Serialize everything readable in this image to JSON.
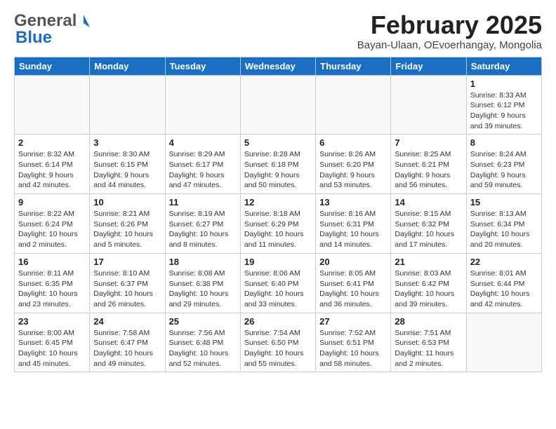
{
  "logo": {
    "general": "General",
    "blue": "Blue"
  },
  "title": "February 2025",
  "location": "Bayan-Ulaan, OEvoerhangay, Mongolia",
  "days_of_week": [
    "Sunday",
    "Monday",
    "Tuesday",
    "Wednesday",
    "Thursday",
    "Friday",
    "Saturday"
  ],
  "weeks": [
    [
      {
        "day": "",
        "info": ""
      },
      {
        "day": "",
        "info": ""
      },
      {
        "day": "",
        "info": ""
      },
      {
        "day": "",
        "info": ""
      },
      {
        "day": "",
        "info": ""
      },
      {
        "day": "",
        "info": ""
      },
      {
        "day": "1",
        "info": "Sunrise: 8:33 AM\nSunset: 6:12 PM\nDaylight: 9 hours and 39 minutes."
      }
    ],
    [
      {
        "day": "2",
        "info": "Sunrise: 8:32 AM\nSunset: 6:14 PM\nDaylight: 9 hours and 42 minutes."
      },
      {
        "day": "3",
        "info": "Sunrise: 8:30 AM\nSunset: 6:15 PM\nDaylight: 9 hours and 44 minutes."
      },
      {
        "day": "4",
        "info": "Sunrise: 8:29 AM\nSunset: 6:17 PM\nDaylight: 9 hours and 47 minutes."
      },
      {
        "day": "5",
        "info": "Sunrise: 8:28 AM\nSunset: 6:18 PM\nDaylight: 9 hours and 50 minutes."
      },
      {
        "day": "6",
        "info": "Sunrise: 8:26 AM\nSunset: 6:20 PM\nDaylight: 9 hours and 53 minutes."
      },
      {
        "day": "7",
        "info": "Sunrise: 8:25 AM\nSunset: 6:21 PM\nDaylight: 9 hours and 56 minutes."
      },
      {
        "day": "8",
        "info": "Sunrise: 8:24 AM\nSunset: 6:23 PM\nDaylight: 9 hours and 59 minutes."
      }
    ],
    [
      {
        "day": "9",
        "info": "Sunrise: 8:22 AM\nSunset: 6:24 PM\nDaylight: 10 hours and 2 minutes."
      },
      {
        "day": "10",
        "info": "Sunrise: 8:21 AM\nSunset: 6:26 PM\nDaylight: 10 hours and 5 minutes."
      },
      {
        "day": "11",
        "info": "Sunrise: 8:19 AM\nSunset: 6:27 PM\nDaylight: 10 hours and 8 minutes."
      },
      {
        "day": "12",
        "info": "Sunrise: 8:18 AM\nSunset: 6:29 PM\nDaylight: 10 hours and 11 minutes."
      },
      {
        "day": "13",
        "info": "Sunrise: 8:16 AM\nSunset: 6:31 PM\nDaylight: 10 hours and 14 minutes."
      },
      {
        "day": "14",
        "info": "Sunrise: 8:15 AM\nSunset: 6:32 PM\nDaylight: 10 hours and 17 minutes."
      },
      {
        "day": "15",
        "info": "Sunrise: 8:13 AM\nSunset: 6:34 PM\nDaylight: 10 hours and 20 minutes."
      }
    ],
    [
      {
        "day": "16",
        "info": "Sunrise: 8:11 AM\nSunset: 6:35 PM\nDaylight: 10 hours and 23 minutes."
      },
      {
        "day": "17",
        "info": "Sunrise: 8:10 AM\nSunset: 6:37 PM\nDaylight: 10 hours and 26 minutes."
      },
      {
        "day": "18",
        "info": "Sunrise: 8:08 AM\nSunset: 6:38 PM\nDaylight: 10 hours and 29 minutes."
      },
      {
        "day": "19",
        "info": "Sunrise: 8:06 AM\nSunset: 6:40 PM\nDaylight: 10 hours and 33 minutes."
      },
      {
        "day": "20",
        "info": "Sunrise: 8:05 AM\nSunset: 6:41 PM\nDaylight: 10 hours and 36 minutes."
      },
      {
        "day": "21",
        "info": "Sunrise: 8:03 AM\nSunset: 6:42 PM\nDaylight: 10 hours and 39 minutes."
      },
      {
        "day": "22",
        "info": "Sunrise: 8:01 AM\nSunset: 6:44 PM\nDaylight: 10 hours and 42 minutes."
      }
    ],
    [
      {
        "day": "23",
        "info": "Sunrise: 8:00 AM\nSunset: 6:45 PM\nDaylight: 10 hours and 45 minutes."
      },
      {
        "day": "24",
        "info": "Sunrise: 7:58 AM\nSunset: 6:47 PM\nDaylight: 10 hours and 49 minutes."
      },
      {
        "day": "25",
        "info": "Sunrise: 7:56 AM\nSunset: 6:48 PM\nDaylight: 10 hours and 52 minutes."
      },
      {
        "day": "26",
        "info": "Sunrise: 7:54 AM\nSunset: 6:50 PM\nDaylight: 10 hours and 55 minutes."
      },
      {
        "day": "27",
        "info": "Sunrise: 7:52 AM\nSunset: 6:51 PM\nDaylight: 10 hours and 58 minutes."
      },
      {
        "day": "28",
        "info": "Sunrise: 7:51 AM\nSunset: 6:53 PM\nDaylight: 11 hours and 2 minutes."
      },
      {
        "day": "",
        "info": ""
      }
    ]
  ]
}
